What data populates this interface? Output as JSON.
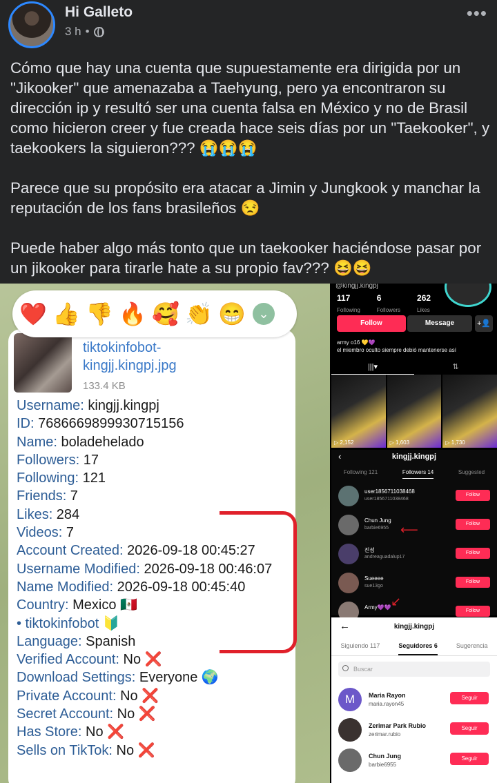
{
  "post": {
    "author": "Hi Galleto",
    "time": "3 h",
    "more": "•••",
    "paragraphs": [
      "Cómo que hay una cuenta que supuestamente era dirigida por un \"Jikooker\" que amenazaba a Taehyung, pero ya encontraron su dirección ip y resultó ser una cuenta falsa en México y no de Brasil como hicieron creer y fue creada hace seis días por un \"Taekooker\", y taekookers la siguieron??? 😭😭😭",
      "Parece que su propósito era atacar a Jimin y Jungkook y manchar la reputación de los fans brasileños 😒",
      "Puede haber algo más tonto que un taekooker haciéndose pasar por un jikooker para tirarle hate a su propio fav??? 😆😆"
    ]
  },
  "telegram": {
    "reactions": [
      "❤️",
      "👍",
      "👎",
      "🔥",
      "🥰",
      "👏",
      "😁"
    ],
    "expand": "⌄",
    "file_name": "tiktokinfobot-kingjj.kingpj.jpg",
    "file_size": "133.4 KB",
    "fields": [
      {
        "k": "Username:",
        "v": " kingjj.kingpj"
      },
      {
        "k": "ID:",
        "v": " 7686669899930715156"
      },
      {
        "k": "Name:",
        "v": " boladehelado"
      },
      {
        "k": "Followers:",
        "v": " 17"
      },
      {
        "k": "Following:",
        "v": " 121"
      },
      {
        "k": "Friends:",
        "v": " 7"
      },
      {
        "k": "Likes:",
        "v": " 284"
      },
      {
        "k": "Videos:",
        "v": " 7"
      },
      {
        "k": "Account Created:",
        "v": " 2026-09-18 00:45:27"
      },
      {
        "k": "Username Modified:",
        "v": " 2026-09-18 00:46:07"
      },
      {
        "k": "Name Modified:",
        "v": " 2026-09-18 00:45:40"
      },
      {
        "k": "Country:",
        "v": " Mexico 🇲🇽"
      },
      {
        "k": "• tiktokinfobot",
        "v": " 🔰"
      },
      {
        "k": "Language:",
        "v": " Spanish"
      },
      {
        "k": "Verified Account:",
        "v": " No ❌"
      },
      {
        "k": "Download Settings:",
        "v": " Everyone 🌍"
      },
      {
        "k": "Private Account:",
        "v": " No ❌"
      },
      {
        "k": "Secret Account:",
        "v": " No ❌"
      },
      {
        "k": "Has Store:",
        "v": " No ❌"
      },
      {
        "k": "Sells on TikTok:",
        "v": " No ❌"
      }
    ]
  },
  "tiktok_profile": {
    "handle": "@kingjj.kingpj",
    "stats": [
      {
        "value": "117",
        "label": "Following"
      },
      {
        "value": "6",
        "label": "Followers"
      },
      {
        "value": "262",
        "label": "Likes"
      }
    ],
    "follow_label": "Follow",
    "message_label": "Message",
    "add_icon": "+👤",
    "bio_line1": "army o16 💛💜",
    "bio_line2": "el miembro oculto siempre debió mantenerse así",
    "tabs": [
      "|||▾",
      "⇅"
    ],
    "videos": [
      {
        "views": "▷ 2,152"
      },
      {
        "views": "▷ 1,603"
      },
      {
        "views": "▷ 1,730"
      }
    ]
  },
  "followers_dark": {
    "back": "‹",
    "title": "kingjj.kingpj",
    "tabs": [
      "Following 121",
      "Followers 14",
      "Suggested"
    ],
    "rows": [
      {
        "name": "user1856711038468",
        "sub": "user1856711038468",
        "btn": "Follow"
      },
      {
        "name": "Chun Jung",
        "sub": "barbie6955",
        "btn": "Follow"
      },
      {
        "name": "진성",
        "sub": "andreaguadalup17",
        "btn": "Follow"
      },
      {
        "name": "Sueeee",
        "sub": "sue13go",
        "btn": "Follow"
      },
      {
        "name": "Army💜💜",
        "sub": "",
        "btn": "Follow"
      }
    ]
  },
  "followers_light": {
    "back": "←",
    "title": "kingjj.kingpj",
    "tabs": [
      "Siguiendo 117",
      "Seguidores 6",
      "Sugerencia"
    ],
    "search_placeholder": "Buscar",
    "rows": [
      {
        "avatar": "M",
        "name": "Maria Rayon",
        "sub": "maria.rayon45",
        "btn": "Seguir"
      },
      {
        "avatar": "",
        "name": "Zerimar Park Rubio",
        "sub": "zerimar.rubio",
        "btn": "Seguir"
      },
      {
        "avatar": "",
        "name": "Chun Jung",
        "sub": "barbie6955",
        "btn": "Seguir"
      }
    ]
  },
  "colors": {
    "background": "#242526",
    "text": "#e4e6eb",
    "muted": "#b0b3b8",
    "tiktok_red": "#fe2c55",
    "annotation_red": "#e0202a",
    "telegram_link": "#3a79c8"
  }
}
